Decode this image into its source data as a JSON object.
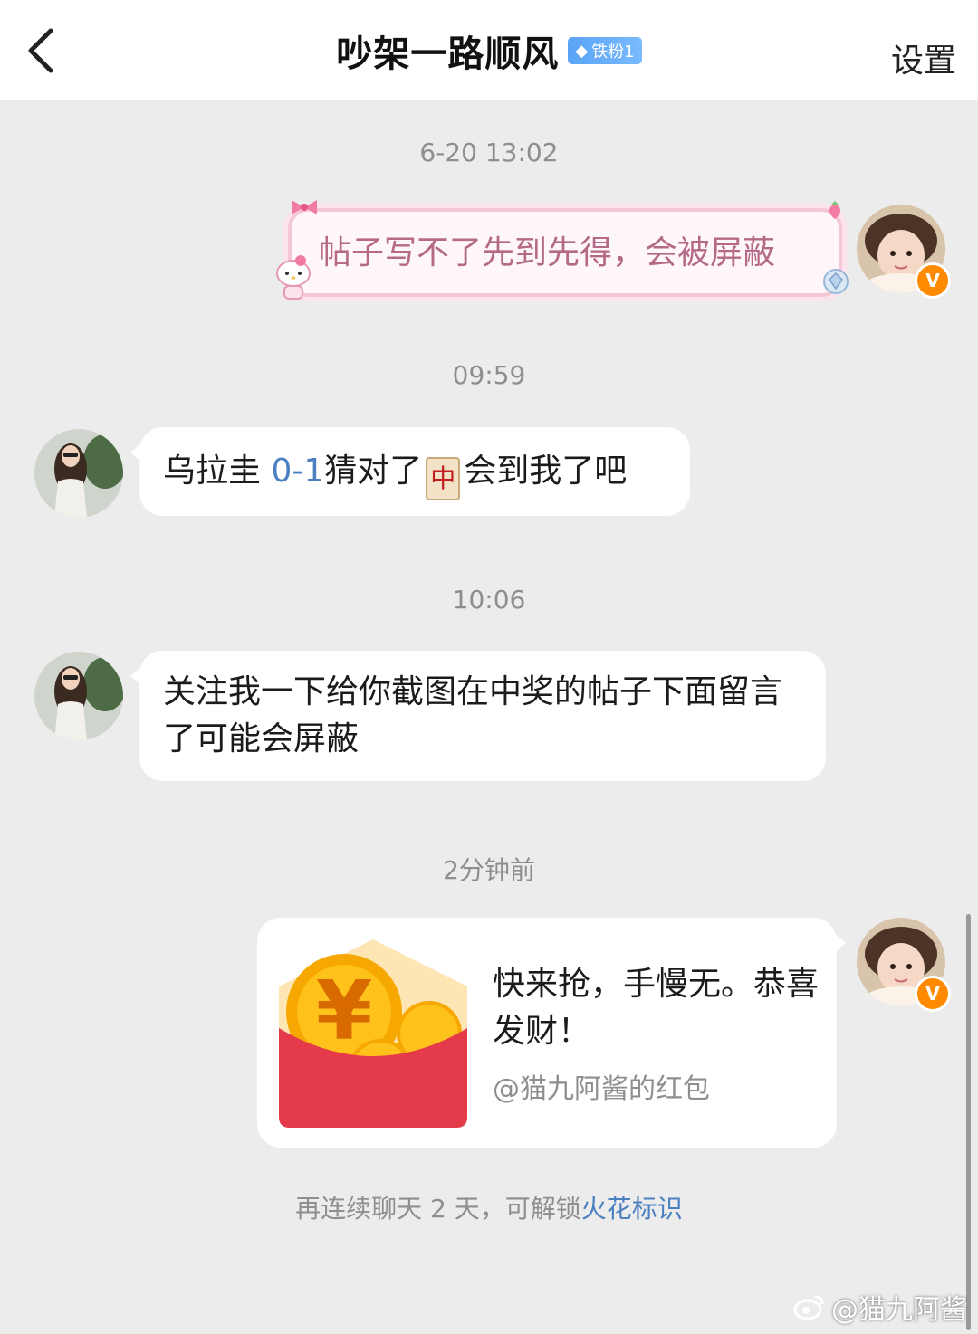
{
  "header": {
    "title": "吵架一路顺风",
    "fan_badge": "铁粉1",
    "settings_label": "设置"
  },
  "messages": [
    {
      "timestamp": "6-20 13:02",
      "side": "right",
      "text": "帖子写不了先到先得，会被屏蔽",
      "avatar_badge": "V"
    },
    {
      "timestamp": "09:59",
      "side": "left",
      "text_before": "乌拉圭 ",
      "link_text": "0-1",
      "text_mid": "猜对了",
      "emoji_char": "中",
      "text_after": "会到我了吧"
    },
    {
      "timestamp": "10:06",
      "side": "left",
      "text": "关注我一下给你截图在中奖的帖子下面留言了可能会屏蔽"
    },
    {
      "timestamp": "2分钟前",
      "side": "right",
      "red_packet": {
        "text": "快来抢，手慢无。恭喜发财！",
        "from": "@猫九阿酱的红包"
      },
      "avatar_badge": "V"
    }
  ],
  "system_note": {
    "prefix": "再连续聊天 2 天，可解锁",
    "highlight": "火花标识"
  },
  "watermark": "@猫九阿酱",
  "colors": {
    "background": "#ececec",
    "link": "#4a7fc0",
    "badge": "#ff8a00",
    "red_packet": "#e53a4a"
  }
}
